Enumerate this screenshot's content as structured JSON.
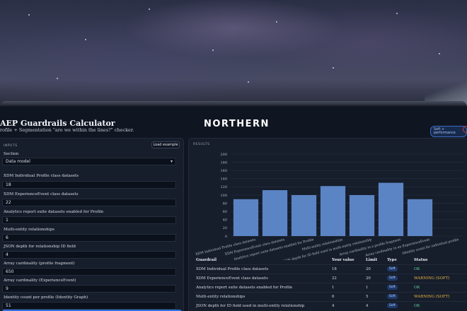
{
  "header": {
    "title": "AEP Guardrails Calculator",
    "subtitle": "rofile + Segmentation \"are we within the lines?\" checker.",
    "logo_text": "NORTHERN",
    "mode_badge": "Soft + performance"
  },
  "inputs": {
    "section_title": "INPUTS",
    "load_example_label": "Load example",
    "section_label": "Section",
    "section_value": "Data model",
    "fields": [
      {
        "label": "XDM Individual Profile class datasets",
        "value": "18"
      },
      {
        "label": "XDM ExperienceEvent class datasets",
        "value": "22"
      },
      {
        "label": "Analytics report suite datasets enabled for Profile",
        "value": "1"
      },
      {
        "label": "Multi-entity relationships",
        "value": "6"
      },
      {
        "label": "JSON depth for relationship ID field",
        "value": "4"
      },
      {
        "label": "Array cardinality (profile fragment)",
        "value": "650"
      },
      {
        "label": "Array cardinality (ExperienceEvent)",
        "value": "9"
      },
      {
        "label": "Identity count per profile (Identity Graph)",
        "value": "51"
      }
    ]
  },
  "results": {
    "section_title": "RESULTS",
    "table": {
      "headers": [
        "Guardrail",
        "Your value",
        "Limit",
        "Type",
        "Status"
      ],
      "rows": [
        {
          "guardrail": "XDM Individual Profile class datasets",
          "value": "18",
          "limit": "20",
          "type": "Soft",
          "status": "OK",
          "status_kind": "ok"
        },
        {
          "guardrail": "XDM ExperienceEvent class datasets",
          "value": "22",
          "limit": "20",
          "type": "Soft",
          "status": "WARNING (SOFT)",
          "status_kind": "warn"
        },
        {
          "guardrail": "Analytics report suite datasets enabled for Profile",
          "value": "1",
          "limit": "1",
          "type": "Soft",
          "status": "OK",
          "status_kind": "ok"
        },
        {
          "guardrail": "Multi-entity relationships",
          "value": "6",
          "limit": "5",
          "type": "Soft",
          "status": "WARNING (SOFT)",
          "status_kind": "warn"
        },
        {
          "guardrail": "JSON depth for ID field used in multi-entity relationship",
          "value": "4",
          "limit": "4",
          "type": "Soft",
          "status": "OK",
          "status_kind": "ok"
        }
      ]
    }
  },
  "colors": {
    "bar": "#5b84c4",
    "accent": "#2f73e0",
    "ok": "#5ed6a0",
    "warn": "#e8b744"
  },
  "chart_data": {
    "type": "bar",
    "categories": [
      "XDM Individual Profile class datasets",
      "XDM ExperienceEvent class datasets",
      "Analytics report suite datasets enabled for Profile",
      "Multi-entity relationships",
      "JSON depth for ID field used in multi-entity relationship",
      "Array cardinality in a profile fragment",
      "Array cardinality in an ExperienceEvent",
      "Identity count for individual profile"
    ],
    "values": [
      90,
      112,
      100,
      122,
      100,
      130,
      90
    ],
    "yticks": [
      0,
      20,
      40,
      60,
      80,
      100,
      120,
      140,
      160,
      180,
      200
    ],
    "ylim": [
      0,
      200
    ],
    "grid": true
  }
}
